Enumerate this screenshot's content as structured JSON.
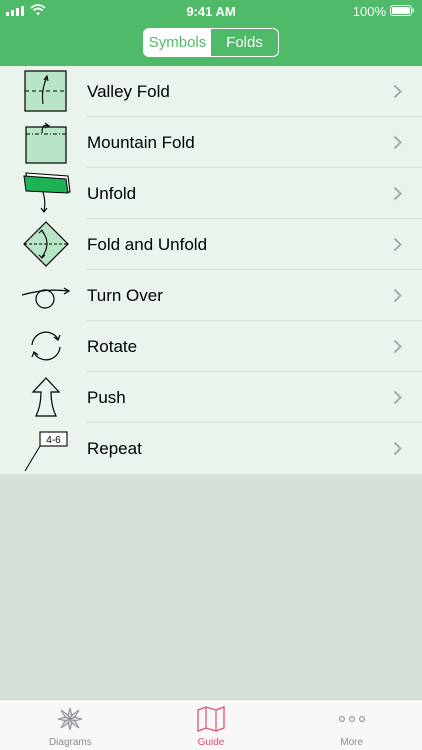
{
  "status_bar": {
    "time": "9:41 AM",
    "battery_percent": "100%"
  },
  "segmented_control": {
    "options": [
      "Symbols",
      "Folds"
    ],
    "selected": "Symbols"
  },
  "symbols": [
    {
      "label": "Valley Fold",
      "icon": "valley-fold-icon"
    },
    {
      "label": "Mountain Fold",
      "icon": "mountain-fold-icon"
    },
    {
      "label": "Unfold",
      "icon": "unfold-icon"
    },
    {
      "label": "Fold and Unfold",
      "icon": "fold-and-unfold-icon"
    },
    {
      "label": "Turn Over",
      "icon": "turn-over-icon"
    },
    {
      "label": "Rotate",
      "icon": "rotate-icon"
    },
    {
      "label": "Push",
      "icon": "push-icon"
    },
    {
      "label": "Repeat",
      "icon": "repeat-icon",
      "badge": "4-6"
    }
  ],
  "tab_bar": {
    "items": [
      {
        "label": "Diagrams",
        "icon": "crane-flower-icon"
      },
      {
        "label": "Guide",
        "icon": "map-icon"
      },
      {
        "label": "More",
        "icon": "more-dots-icon"
      }
    ],
    "selected": "Guide"
  },
  "colors": {
    "accent": "#4fbb68",
    "list_background": "#eaf3ec",
    "page_background": "#d6e1d7",
    "selected_tab": "#e0506e",
    "paper": "#b7e5c5"
  }
}
